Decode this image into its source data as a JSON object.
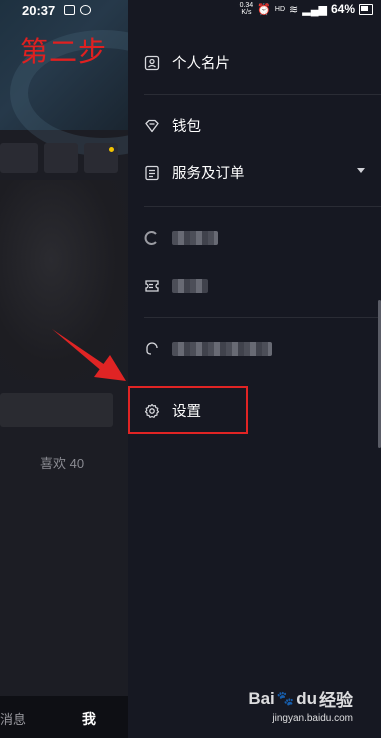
{
  "status_bar": {
    "time": "20:37",
    "net_speed_top": "0.34",
    "net_speed_unit": "K/s",
    "hd": "HD",
    "battery": "64%"
  },
  "step_label": "第二步",
  "background": {
    "likes": "喜欢 40",
    "nav_messages": "消息",
    "nav_me": "我"
  },
  "drawer": {
    "items": [
      {
        "label": "个人名片",
        "icon": "id-card-icon"
      },
      {
        "label": "钱包",
        "icon": "diamond-wallet-icon"
      },
      {
        "label": "服务及订单",
        "icon": "document-list-icon"
      },
      {
        "label": "",
        "icon": "blurred-icon"
      },
      {
        "label": "",
        "icon": "ticket-icon"
      },
      {
        "label": "",
        "icon": "headset-icon"
      },
      {
        "label": "设置",
        "icon": "gear-icon"
      }
    ]
  },
  "watermark": {
    "brand": "Bai",
    "brand2": "du",
    "suffix": "经验",
    "url": "jingyan.baidu.com"
  },
  "colors": {
    "accent_red": "#e02424",
    "drawer_bg": "#161822"
  }
}
